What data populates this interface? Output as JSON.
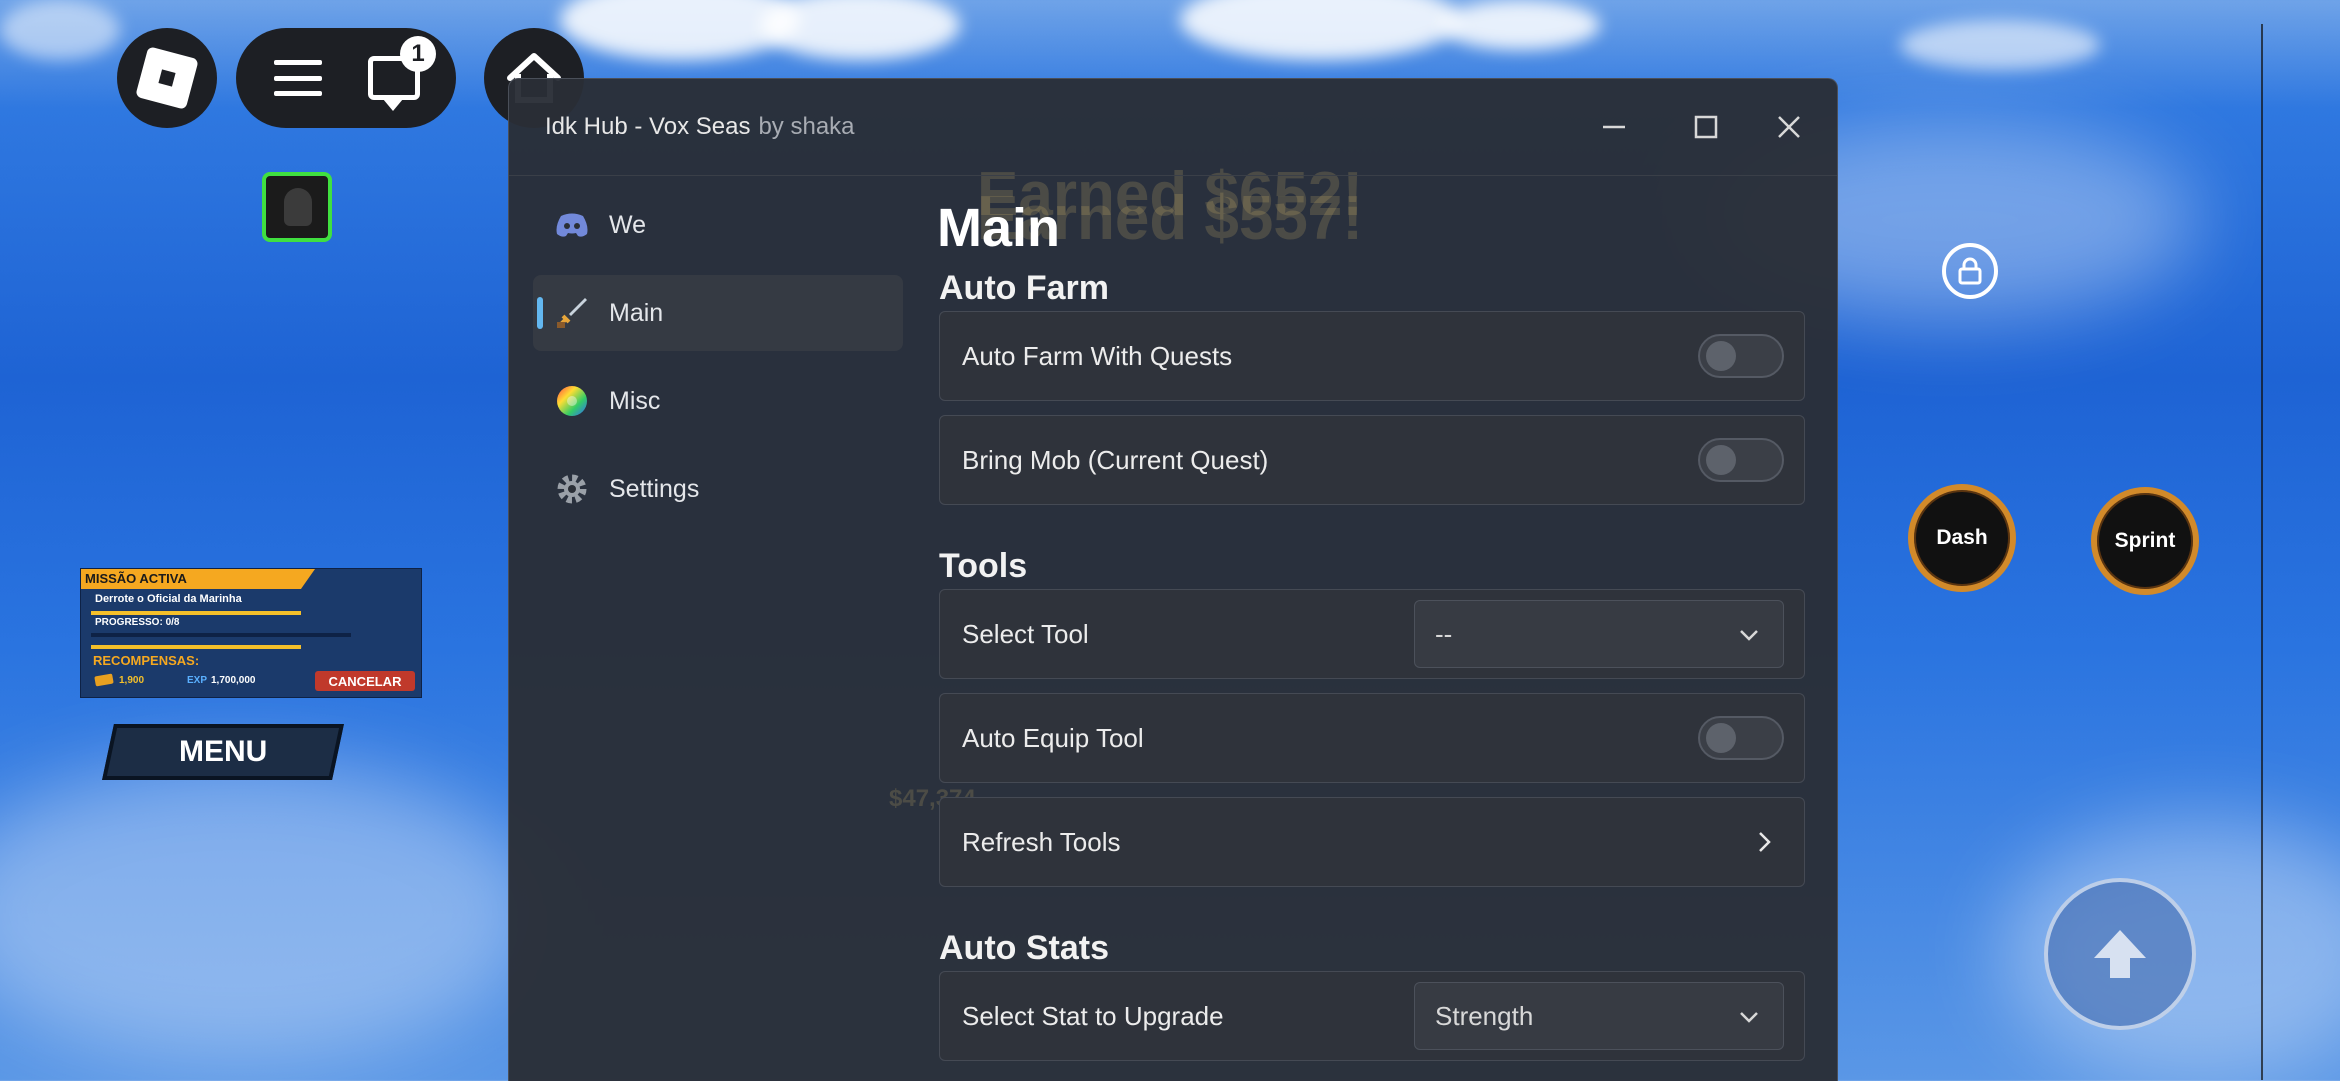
{
  "top_bar": {
    "chat_badge": "1"
  },
  "quest": {
    "header": "MISSÃO ACTIVA",
    "objective": "Derrote o Oficial da Marinha",
    "progress": "PROGRESSO: 0/8",
    "rewards_label": "RECOMPENSAS:",
    "gold": "1,900",
    "exp_label": "EXP",
    "exp_value": "1,700,000",
    "cancel": "CANCELAR"
  },
  "game_menu_label": "MENU",
  "right_buttons": {
    "dash": "Dash",
    "sprint": "Sprint"
  },
  "window": {
    "title": "Idk Hub - Vox Seas",
    "subtitle": "by shaka"
  },
  "sidebar": {
    "items": [
      {
        "label": "We",
        "icon": "discord-icon"
      },
      {
        "label": "Main",
        "icon": "sword-icon"
      },
      {
        "label": "Misc",
        "icon": "color-wheel-icon"
      },
      {
        "label": "Settings",
        "icon": "gear-icon"
      }
    ],
    "active": "Main"
  },
  "main": {
    "title": "Main",
    "sections": {
      "auto_farm": "Auto Farm",
      "tools": "Tools",
      "auto_stats": "Auto Stats"
    },
    "rows": {
      "auto_farm_quests": "Auto Farm With Quests",
      "bring_mob": "Bring Mob (Current Quest)",
      "select_tool": "Select Tool",
      "select_tool_value": "--",
      "auto_equip": "Auto Equip Tool",
      "refresh_tools": "Refresh Tools",
      "select_stat": "Select Stat to Upgrade",
      "select_stat_value": "Strength"
    }
  },
  "background_hud": {
    "earned_1": "Earned $652!",
    "earned_2": "Earned $557!",
    "money": "$47,374"
  },
  "colors": {
    "accent": "#63b7f0",
    "window_bg": "#2a2e36",
    "quest_gold": "#f5a820",
    "cancel_red": "#c0392b"
  }
}
